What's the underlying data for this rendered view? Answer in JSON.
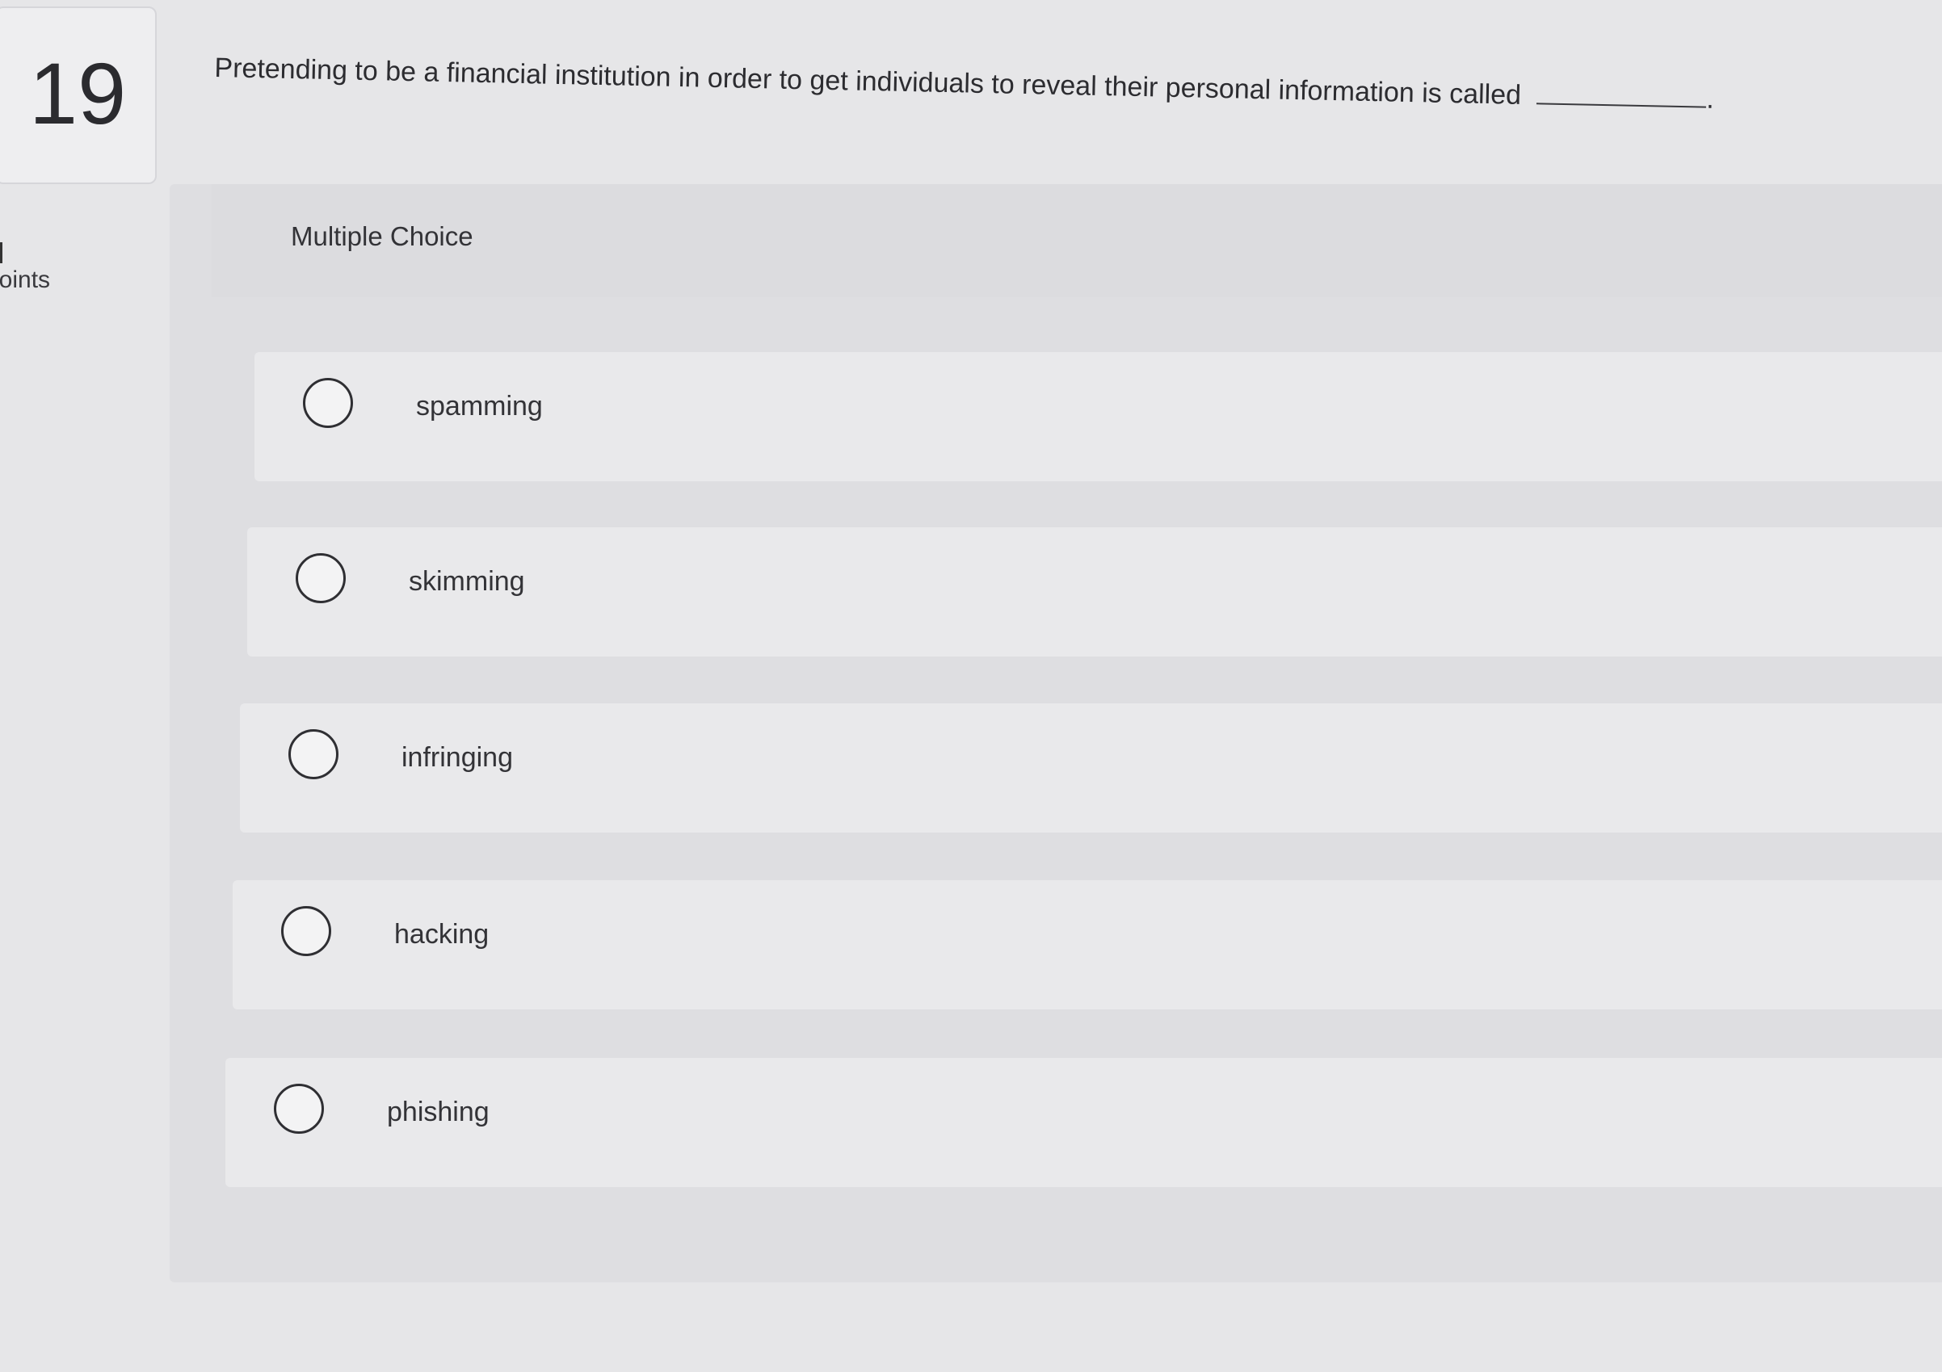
{
  "question": {
    "number": "19",
    "text": "Pretending to be a financial institution in order to get individuals to reveal their personal information is called",
    "trailing_punctuation": ".",
    "points_label": "points"
  },
  "choice_section": {
    "type_label": "Multiple Choice"
  },
  "options": [
    {
      "label": "spamming",
      "selected": false
    },
    {
      "label": "skimming",
      "selected": false
    },
    {
      "label": "infringing",
      "selected": false
    },
    {
      "label": "hacking",
      "selected": false
    },
    {
      "label": "phishing",
      "selected": false
    }
  ]
}
